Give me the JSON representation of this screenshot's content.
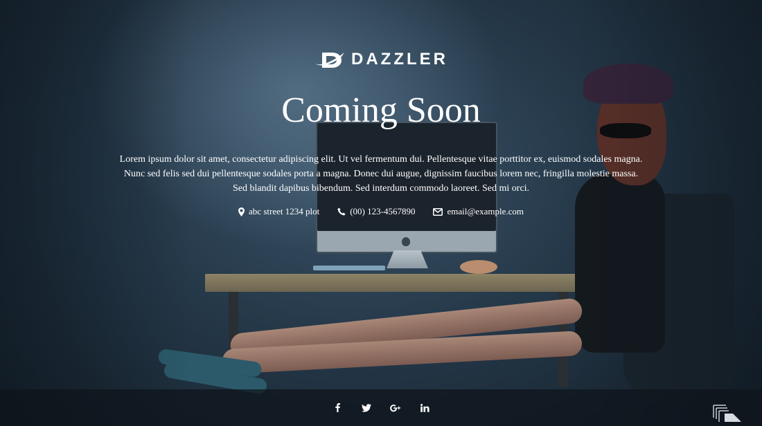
{
  "brand": {
    "name": "DAZZLER",
    "logo_icon": "dazzler-logo-icon"
  },
  "hero": {
    "title": "Coming Soon",
    "description_lines": [
      "Lorem ipsum dolor sit amet, consectetur adipiscing elit. Ut vel fermentum dui. Pellentesque vitae porttitor ex, euismod sodales magna.",
      "Nunc sed felis sed dui pellentesque sodales porta a magna. Donec dui augue, dignissim faucibus lorem nec, fringilla molestie massa.",
      "Sed blandit dapibus bibendum. Sed interdum commodo laoreet. Sed mi orci."
    ]
  },
  "contact": {
    "address": {
      "icon": "map-marker-icon",
      "text": "abc street 1234 plot"
    },
    "phone": {
      "icon": "phone-icon",
      "text": "(00) 123-4567890"
    },
    "email": {
      "icon": "envelope-icon",
      "text": "email@example.com"
    }
  },
  "footer": {
    "social": [
      {
        "icon": "facebook-icon"
      },
      {
        "icon": "twitter-icon"
      },
      {
        "icon": "google-plus-icon"
      },
      {
        "icon": "linkedin-icon"
      }
    ],
    "scroll_icon": "scroll-up-icon"
  },
  "colors": {
    "text": "#ffffff",
    "footer_bg": "#0e141a",
    "background": "#263a4b"
  }
}
